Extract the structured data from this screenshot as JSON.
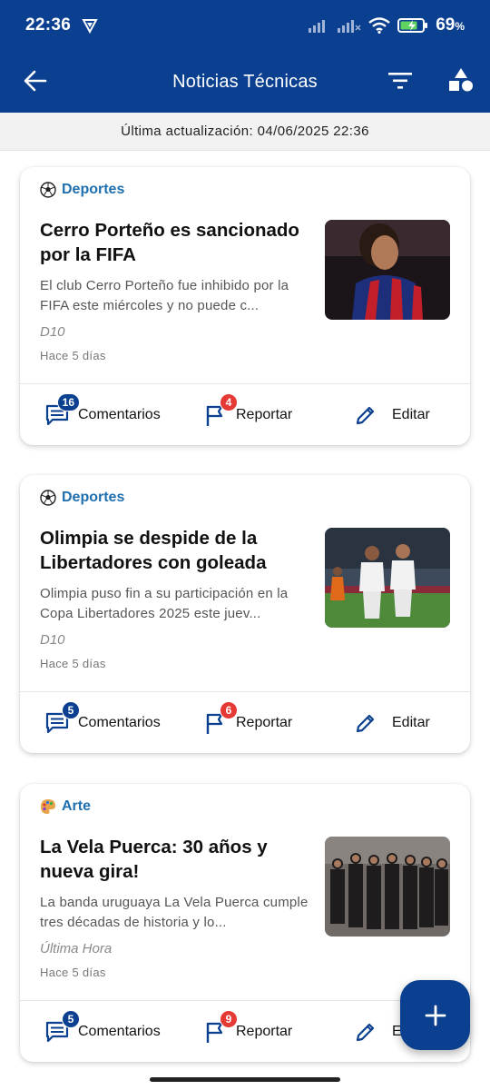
{
  "status_bar": {
    "time": "22:36",
    "battery_percent": "69",
    "battery_unit": "%",
    "icons": [
      "shield-icon",
      "signal-icon",
      "signal-icon",
      "wifi-icon",
      "battery-charging-icon"
    ]
  },
  "app_bar": {
    "title": "Noticias Técnicas",
    "back_icon": "arrow-left-icon",
    "filter_icon": "filter-icon",
    "shapes_icon": "category-shapes-icon"
  },
  "update": {
    "text": "Última actualización: 04/06/2025 22:36"
  },
  "colors": {
    "primary": "#0b3f8f",
    "category": "#1f6fae",
    "badge_red": "#e53935"
  },
  "cards": [
    {
      "category_icon": "soccer-ball-icon",
      "category": "Deportes",
      "title": "Cerro Porteño es sancionado por la FIFA",
      "summary": "El club Cerro Porteño fue inhibido por la FIFA este miércoles y no puede c...",
      "source": "D10",
      "time": "Hace 5 días",
      "image": "soccer-player-photo",
      "comments_label": "Comentarios",
      "comments_count": "16",
      "report_label": "Reportar",
      "report_count": "4",
      "edit_label": "Editar"
    },
    {
      "category_icon": "soccer-ball-icon",
      "category": "Deportes",
      "title": "Olimpia se despide de la Libertadores con goleada",
      "summary": "Olimpia puso fin a su participación en la Copa Libertadores 2025 este juev...",
      "source": "D10",
      "time": "Hace 5 días",
      "image": "soccer-match-photo",
      "comments_label": "Comentarios",
      "comments_count": "5",
      "report_label": "Reportar",
      "report_count": "6",
      "edit_label": "Editar"
    },
    {
      "category_icon": "palette-icon",
      "category": "Arte",
      "title": "La Vela Puerca: 30 años y nueva gira!",
      "summary": "La banda uruguaya La Vela Puerca cumple tres décadas de historia y lo...",
      "source": "Última Hora",
      "time": "Hace 5 días",
      "image": "band-group-photo",
      "comments_label": "Comentarios",
      "comments_count": "5",
      "report_label": "Reportar",
      "report_count": "9",
      "edit_label": "Ed"
    }
  ],
  "fab": {
    "icon": "plus-icon"
  }
}
